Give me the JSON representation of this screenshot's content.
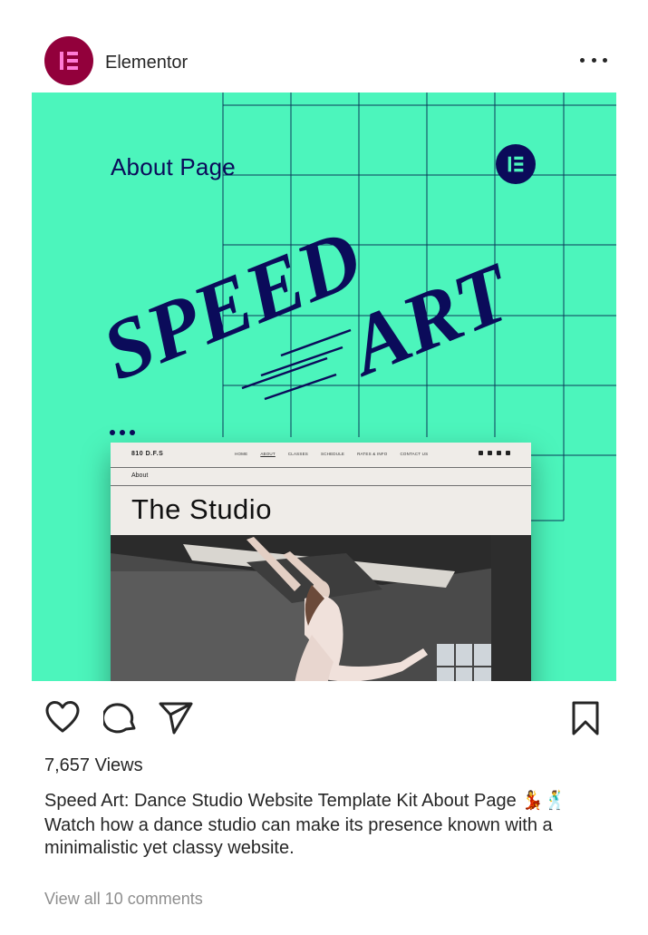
{
  "post": {
    "username": "Elementor",
    "views": "7,657 Views",
    "caption_title": "Speed Art: Dance Studio Website Template Kit About Page 💃🕺",
    "caption_body": "Watch how a dance studio can make its presence known with a minimalistic yet classy website.",
    "view_comments": "View all 10 comments"
  },
  "media": {
    "label": "About Page",
    "headline_1": "SPEED",
    "headline_2": "ART",
    "mock_site": {
      "logo": "810 D.F.S",
      "nav": [
        "HOME",
        "ABOUT",
        "CLASSES",
        "SCHEDULE",
        "RATES & INFO",
        "CONTACT US"
      ],
      "breadcrumb": "About",
      "title": "The Studio"
    }
  },
  "icons": {
    "avatar": "elementor-logo-icon",
    "more": "more-options-icon",
    "like": "heart-icon",
    "comment": "comment-bubble-icon",
    "share": "paper-plane-icon",
    "save": "bookmark-icon"
  },
  "colors": {
    "brand": "#92003b",
    "media_bg": "#4cf5bc",
    "navy": "#0b0b5a",
    "muted_text": "#8e8e8e"
  }
}
